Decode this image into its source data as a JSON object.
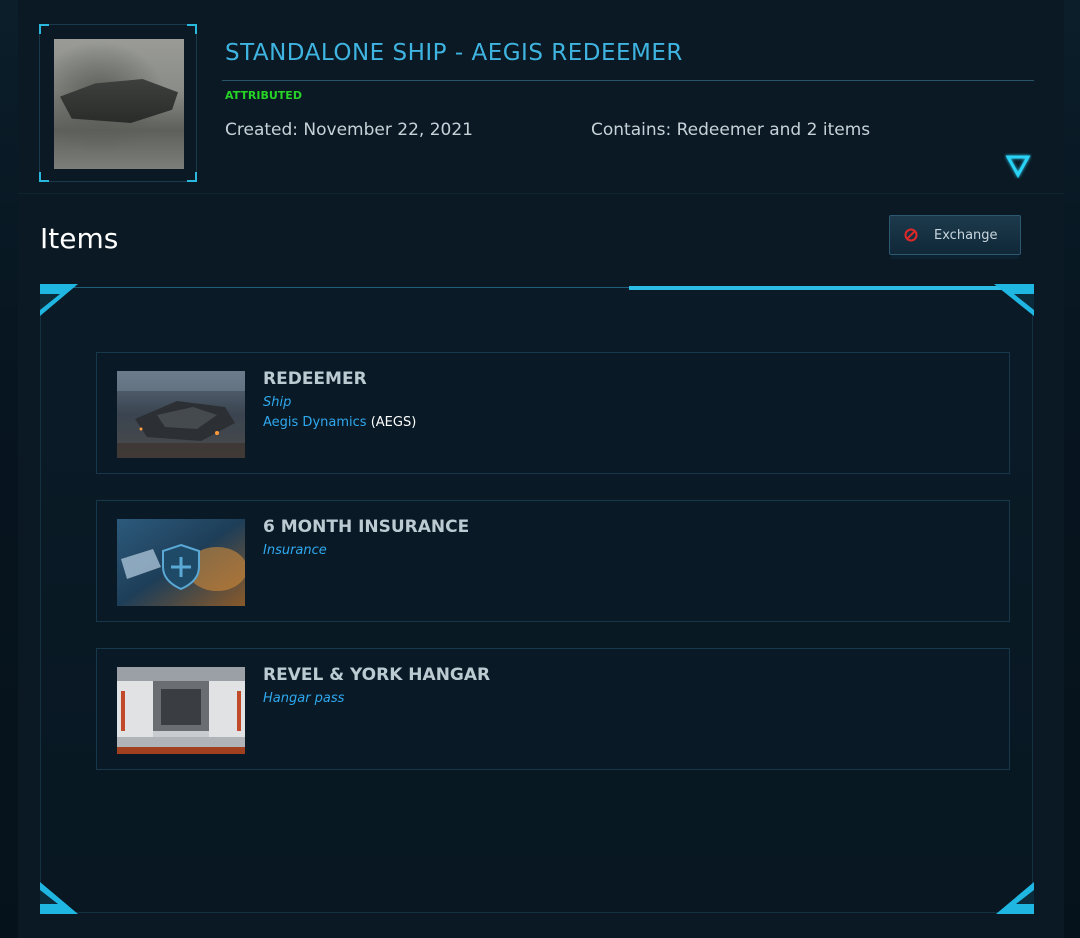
{
  "pledge": {
    "title": "STANDALONE SHIP - AEGIS REDEEMER",
    "status": "ATTRIBUTED",
    "created": "Created: November 22, 2021",
    "contains": "Contains: Redeemer and 2 items",
    "expand_icon": "triangle-down-icon"
  },
  "items_section": {
    "heading": "Items",
    "exchange_label": "Exchange",
    "exchange_icon": "no-entry-icon"
  },
  "items": [
    {
      "title": "REDEEMER",
      "type": "Ship",
      "manufacturer_name": "Aegis Dynamics",
      "manufacturer_code": "(AEGS)"
    },
    {
      "title": "6 MONTH INSURANCE",
      "type": "Insurance"
    },
    {
      "title": "REVEL & YORK HANGAR",
      "type": "Hangar pass"
    }
  ],
  "colors": {
    "accent": "#2bbde6",
    "title_blue": "#3fb4e0",
    "status_green": "#26d326",
    "link_blue": "#2fa8ee",
    "exchange_icon_red": "#e02828"
  }
}
